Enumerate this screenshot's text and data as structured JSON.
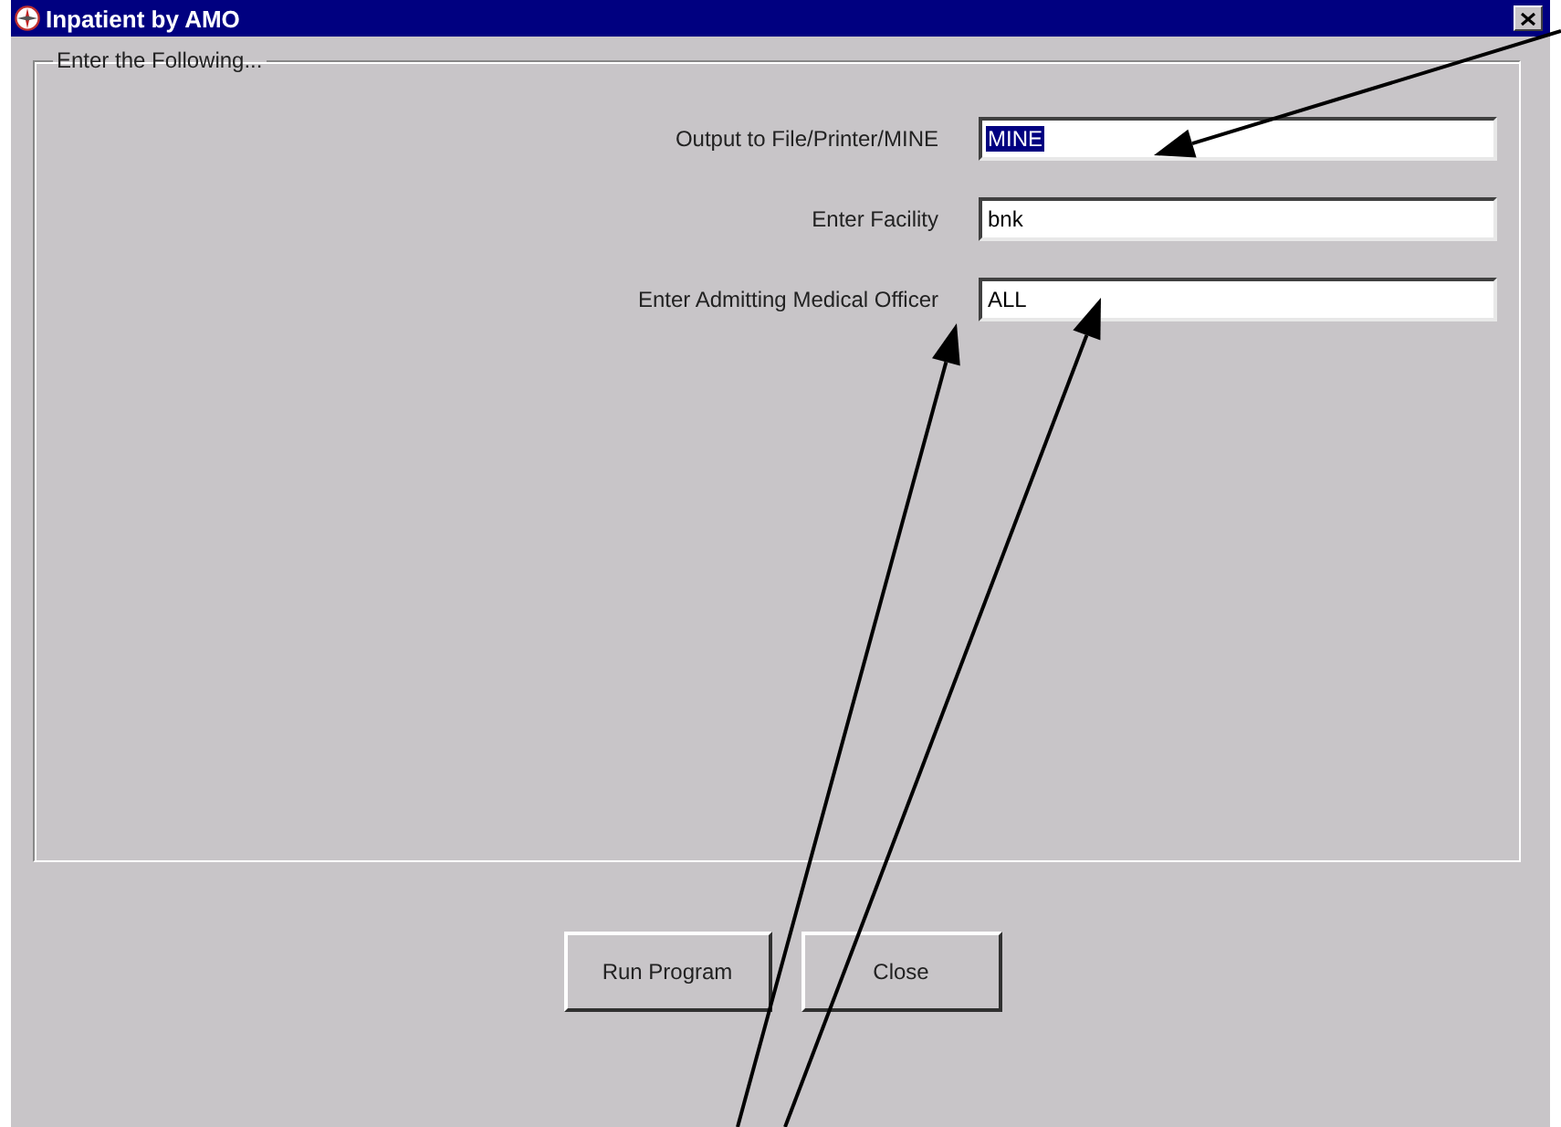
{
  "window": {
    "title": "Inpatient by AMO"
  },
  "group": {
    "title": "Enter the Following..."
  },
  "fields": [
    {
      "label": "Output to File/Printer/MINE",
      "value": "MINE",
      "text_highlighted": true
    },
    {
      "label": "Enter Facility",
      "value": "bnk",
      "text_highlighted": false
    },
    {
      "label": "Enter Admitting Medical Officer",
      "value": "ALL",
      "text_highlighted": false
    }
  ],
  "buttons": [
    {
      "label": "Run Program"
    },
    {
      "label": "Close"
    }
  ]
}
